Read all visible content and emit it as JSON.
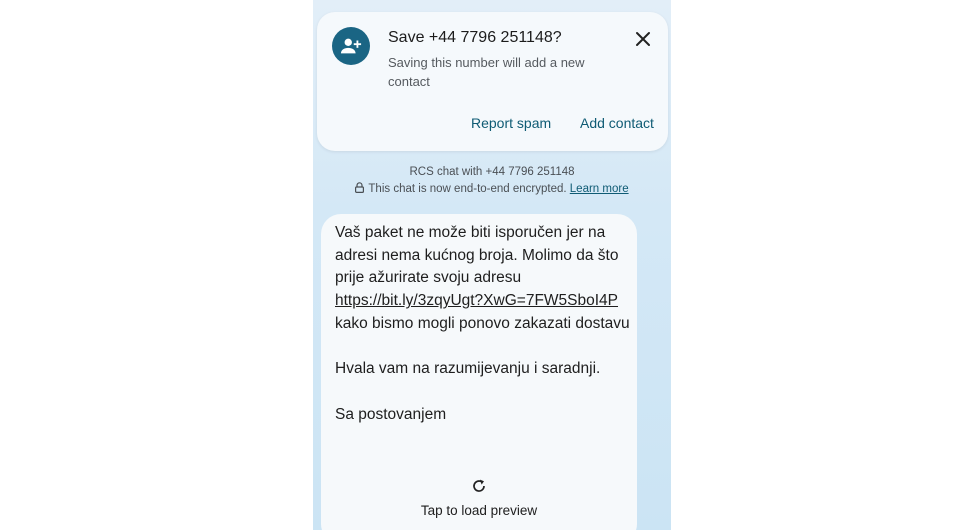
{
  "save_card": {
    "title": "Save +44 7796 251148?",
    "subtitle": "Saving this number will add a new contact",
    "avatar_icon": "add-person-icon",
    "close_icon": "close-icon",
    "report_spam_label": "Report spam",
    "add_contact_label": "Add contact",
    "accent_color": "#1a6584"
  },
  "chat_info": {
    "line1": "RCS chat with +44 7796 251148",
    "line2": "This chat is now end-to-end encrypted.",
    "learn_more": "Learn more",
    "lock_icon": "lock-icon"
  },
  "message": {
    "paragraph1_text": "Vaš paket ne može biti isporučen jer na adresi nema kućnog broja. Molimo da što prije ažurirate svoju adresu",
    "link": "https://bit.ly/3zqyUgt?XwG=7FW5SboI4P",
    "paragraph1_end": "kako bismo mogli ponovo zakazati dostavu",
    "paragraph2": "Hvala vam na razumijevanju i saradnji.",
    "paragraph3": "Sa postovanjem"
  },
  "preview": {
    "label": "Tap to load preview",
    "icon": "refresh-icon"
  }
}
